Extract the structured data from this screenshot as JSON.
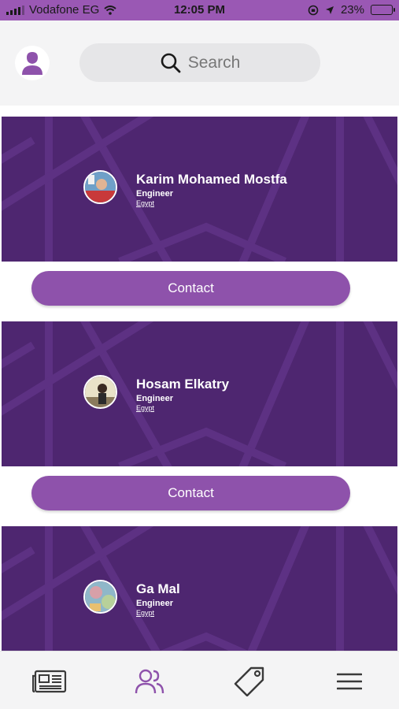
{
  "status_bar": {
    "carrier": "Vodafone EG",
    "time": "12:05 PM",
    "battery": "23%",
    "battery_level": 0.23
  },
  "header": {
    "search_placeholder": "Search",
    "icons": [
      "user-avatar-icon",
      "search-icon"
    ]
  },
  "people": [
    {
      "name": "Karim Mohamed Mostfa",
      "role": "Engineer",
      "country": "Egypt",
      "contact_label": "Contact"
    },
    {
      "name": "Hosam Elkatry",
      "role": "Engineer",
      "country": "Egypt",
      "contact_label": "Contact"
    },
    {
      "name": "Ga Mal",
      "role": "Engineer",
      "country": "Egypt"
    }
  ],
  "tab_bar": {
    "tabs": [
      {
        "icon": "news-icon",
        "active": false
      },
      {
        "icon": "people-icon",
        "active": true
      },
      {
        "icon": "tag-icon",
        "active": false
      },
      {
        "icon": "menu-icon",
        "active": false
      }
    ]
  },
  "colors": {
    "accent": "#9a58b4",
    "banner": "#4e2670",
    "button": "#8e52ab",
    "active_tab": "#8e52ab",
    "inactive_tab": "#3a3a3a"
  }
}
